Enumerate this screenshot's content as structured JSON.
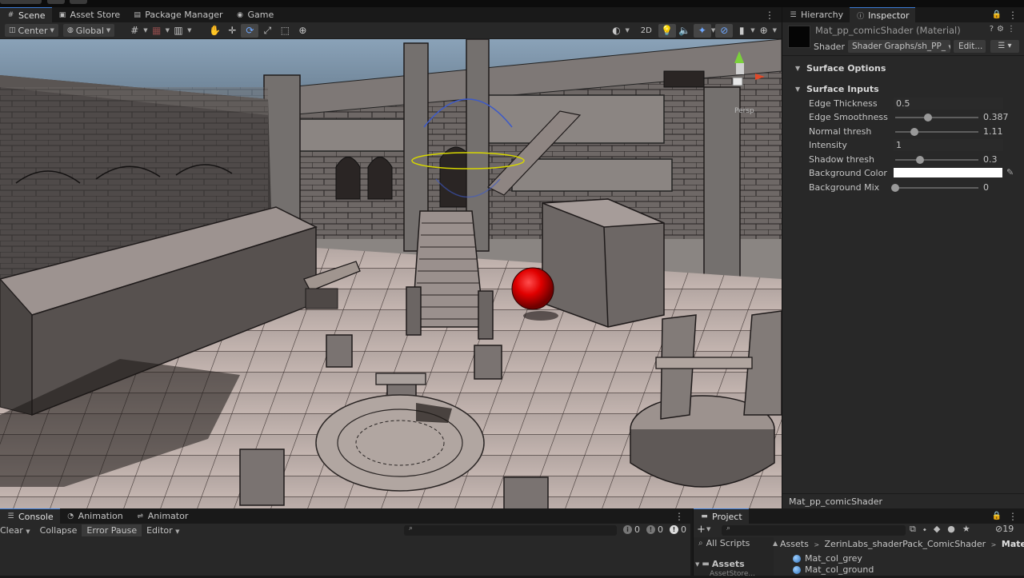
{
  "scene_tabs": [
    {
      "label": "Scene",
      "icon": "grid-icon",
      "active": true
    },
    {
      "label": "Asset Store",
      "icon": "store-icon"
    },
    {
      "label": "Package Manager",
      "icon": "package-icon"
    },
    {
      "label": "Game",
      "icon": "gamepad-icon"
    }
  ],
  "scene_toolbar": {
    "pivot": "Center",
    "space": "Global",
    "mode_2d": "2D"
  },
  "right_tabs": {
    "hierarchy": "Hierarchy",
    "inspector": "Inspector"
  },
  "inspector": {
    "title": "Mat_pp_comicShader (Material)",
    "shader_label": "Shader",
    "shader_value": "Shader Graphs/sh_PP_",
    "edit_label": "Edit...",
    "surface_options": "Surface Options",
    "surface_inputs": "Surface Inputs",
    "properties": [
      {
        "label": "Edge Thickness",
        "value": "0.5",
        "kind": "field"
      },
      {
        "label": "Edge Smoothness",
        "value": "0.387",
        "kind": "slider",
        "fraction": 0.39
      },
      {
        "label": "Normal thresh",
        "value": "1.11",
        "kind": "slider",
        "fraction": 0.23
      },
      {
        "label": "Intensity",
        "value": "1",
        "kind": "field"
      },
      {
        "label": "Shadow thresh",
        "value": "0.3",
        "kind": "slider",
        "fraction": 0.3
      },
      {
        "label": "Background Color",
        "value": "#ffffff",
        "kind": "color"
      },
      {
        "label": "Background Mix",
        "value": "0",
        "kind": "slider",
        "fraction": 0.0
      }
    ],
    "footer": "Mat_pp_comicShader"
  },
  "console_tabs": [
    {
      "label": "Console",
      "icon": "console-icon",
      "active": true
    },
    {
      "label": "Animation",
      "icon": "animation-icon"
    },
    {
      "label": "Animator",
      "icon": "animator-icon"
    }
  ],
  "console_toolbar": {
    "clear": "Clear",
    "collapse": "Collapse",
    "error_pause": "Error Pause",
    "editor": "Editor",
    "log_count": "0",
    "warn_count": "0",
    "error_count": "0"
  },
  "project": {
    "tab": "Project",
    "filter_all_scripts": "All Scripts",
    "tree_root": "Assets",
    "tree_child": "AssetStore...",
    "breadcrumb": [
      "Assets",
      "ZerinLabs_shaderPack_ComicShader",
      "Materials"
    ],
    "hidden_count": "19",
    "assets": [
      "Mat_col_grey",
      "Mat_col_ground"
    ]
  },
  "colors": {
    "accent": "#3b7bd5",
    "panel_bg": "#282828",
    "tab_bg": "#191919",
    "ball_red": "#e00000"
  }
}
